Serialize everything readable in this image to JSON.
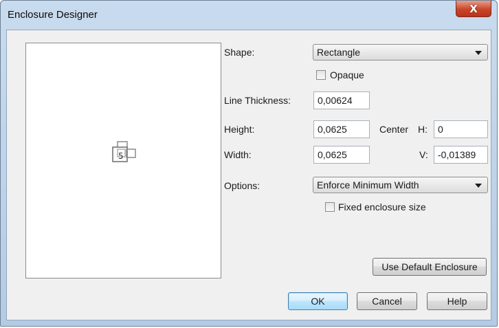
{
  "window": {
    "title": "Enclosure Designer",
    "close_glyph": "X"
  },
  "form": {
    "shape_label": "Shape:",
    "shape_value": "Rectangle",
    "opaque_label": "Opaque",
    "opaque_checked": false,
    "line_thickness_label": "Line Thickness:",
    "line_thickness_value": "0,00624",
    "height_label": "Height:",
    "height_value": "0,0625",
    "width_label": "Width:",
    "width_value": "0,0625",
    "center_label": "Center",
    "center_h_label": "H:",
    "center_h_value": "0",
    "center_v_label": "V:",
    "center_v_value": "-0,01389",
    "options_label": "Options:",
    "options_value": "Enforce Minimum Width",
    "fixed_size_label": "Fixed enclosure size",
    "fixed_size_checked": false
  },
  "buttons": {
    "use_default": "Use Default Enclosure",
    "ok": "OK",
    "cancel": "Cancel",
    "help": "Help"
  },
  "preview": {
    "symbol_glyph": "5"
  },
  "icons": {
    "close": "close-icon",
    "dropdown": "chevron-down-icon",
    "preview_symbol": "enclosure-preview-icon"
  },
  "colors": {
    "title_bar": "#c9dbee",
    "close_button": "#c9462a",
    "dialog_face": "#f0f0f0",
    "default_button": "#bee6fd"
  }
}
